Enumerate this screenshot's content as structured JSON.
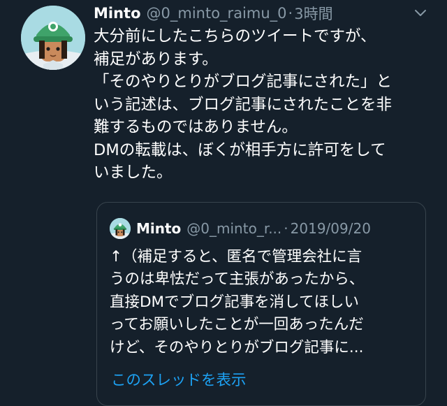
{
  "tweet": {
    "name": "Minto",
    "handle": "@0_minto_raimu_0",
    "separator": "·",
    "time": "3時間",
    "lines": [
      "大分前にしたこちらのツイートですが、",
      "補足があります。",
      "「そのやりとりがブログ記事にされた」と",
      "いう記述は、ブログ記事にされたことを非",
      "難するものではありません。",
      "DMの転載は、ぼくが相手方に許可をして",
      "いました。"
    ]
  },
  "quote": {
    "name": "Minto",
    "handle": "@0_minto_r...",
    "separator": "·",
    "date": "2019/09/20",
    "lines": [
      "↑（補足すると、匿名で管理会社に言",
      "うのは卑怯だって主張があったから、",
      "直接DMでブログ記事を消してほしい",
      "ってお願いしたことが一回あったんだ",
      "けど、そのやりとりがブログ記事に..."
    ],
    "thread_link": "このスレッドを表示"
  },
  "colors": {
    "background": "#15202b",
    "secondary_text": "#8899a6",
    "link": "#1da1f2",
    "border": "#38444d"
  },
  "icons": {
    "avatar": "character-avatar",
    "caret": "chevron-down-icon"
  }
}
